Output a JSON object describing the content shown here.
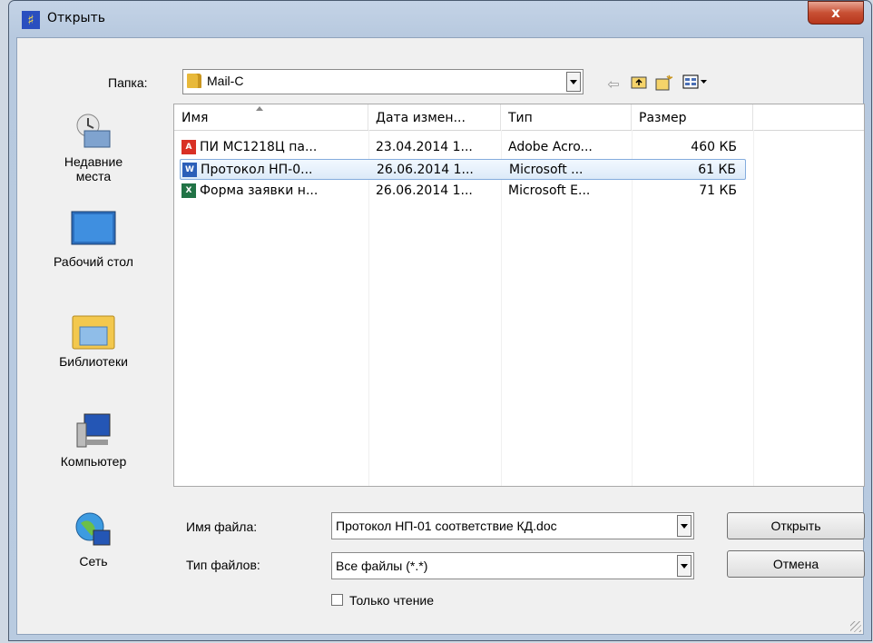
{
  "window": {
    "title": "Открыть",
    "close_label": "x"
  },
  "folder_bar": {
    "label": "Папка:",
    "value": "Mail-C"
  },
  "places": [
    {
      "label": "Недавние места",
      "icon": "recent-places-icon"
    },
    {
      "label": "Рабочий стол",
      "icon": "desktop-icon"
    },
    {
      "label": "Библиотеки",
      "icon": "libraries-icon"
    },
    {
      "label": "Компьютер",
      "icon": "computer-icon"
    },
    {
      "label": "Сеть",
      "icon": "network-icon"
    }
  ],
  "columns": [
    "Имя",
    "Дата измен...",
    "Тип",
    "Размер"
  ],
  "files": [
    {
      "name": "ПИ МС1218Ц па...",
      "date": "23.04.2014 1...",
      "type": "Adobe Acro...",
      "size": "460 КБ",
      "icon": "pdf-file-icon",
      "selected": false
    },
    {
      "name": "Протокол НП-0...",
      "date": "26.06.2014 1...",
      "type": "Microsoft ...",
      "size": "61 КБ",
      "icon": "word-file-icon",
      "selected": true
    },
    {
      "name": "Форма заявки н...",
      "date": "26.06.2014 1...",
      "type": "Microsoft E...",
      "size": "71 КБ",
      "icon": "excel-file-icon",
      "selected": false
    }
  ],
  "filename": {
    "label": "Имя файла:",
    "value": "Протокол НП-01 соответствие КД.doc"
  },
  "filetype": {
    "label": "Тип файлов:",
    "value": "Все файлы (*.*)"
  },
  "readonly": {
    "label": "Только чтение",
    "checked": false
  },
  "buttons": {
    "open": "Открыть",
    "cancel": "Отмена"
  }
}
